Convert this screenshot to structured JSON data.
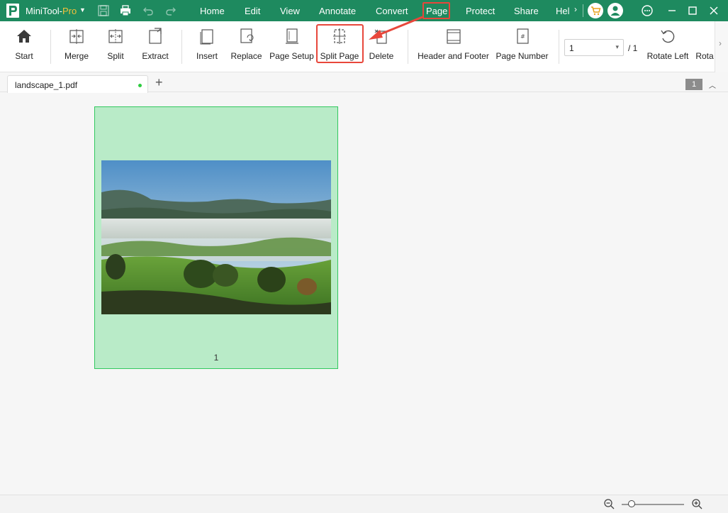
{
  "app": {
    "name": "MiniTool-",
    "name_suffix": "Pro"
  },
  "menu": {
    "items": [
      "Home",
      "Edit",
      "View",
      "Annotate",
      "Convert",
      "Page",
      "Protect",
      "Share",
      "Help"
    ],
    "active": "Page",
    "more_glyph": "›"
  },
  "ribbon": {
    "buttons": [
      {
        "label": "Start",
        "icon": "home-icon"
      },
      {
        "label": "Merge",
        "icon": "merge-icon"
      },
      {
        "label": "Split",
        "icon": "split-icon"
      },
      {
        "label": "Extract",
        "icon": "extract-icon"
      },
      {
        "label": "Insert",
        "icon": "insert-page-icon"
      },
      {
        "label": "Replace",
        "icon": "replace-page-icon"
      },
      {
        "label": "Page Setup",
        "icon": "page-setup-icon"
      },
      {
        "label": "Split Page",
        "icon": "split-page-icon"
      },
      {
        "label": "Delete",
        "icon": "delete-page-icon"
      },
      {
        "label": "Header and Footer",
        "icon": "header-footer-icon"
      },
      {
        "label": "Page Number",
        "icon": "page-number-icon"
      },
      {
        "label": "Rotate Left",
        "icon": "rotate-left-icon"
      },
      {
        "label": "Rota",
        "icon": "rotate-right-icon"
      }
    ],
    "highlighted": "Split Page",
    "page_select_value": "1",
    "page_total": "/ 1",
    "page_number_icon_glyph": "#"
  },
  "tabs": {
    "document": "landscape_1.pdf",
    "add_glyph": "+",
    "page_badge": "1",
    "collapse_glyph": "︿"
  },
  "document": {
    "page_label": "1"
  },
  "colors": {
    "titlebar": "#1e8a5f",
    "highlight": "#e8473b",
    "thumbnail_bg": "#b9ebc8",
    "thumbnail_border": "#32c85f",
    "pro_text": "#f3c13a"
  }
}
